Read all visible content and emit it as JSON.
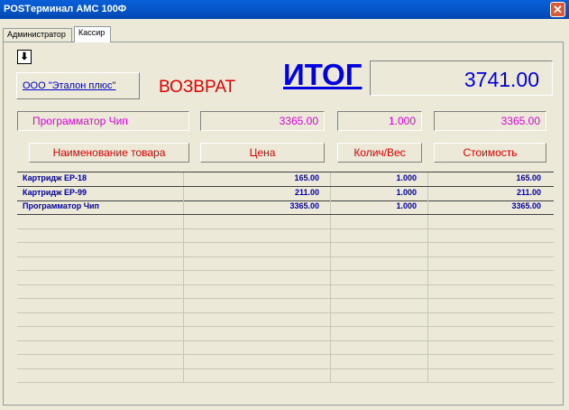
{
  "window": {
    "title": "POSTерминал АМС 100Ф"
  },
  "tabs": [
    {
      "label": "Администратор"
    },
    {
      "label": "Кассир"
    }
  ],
  "toolbar": {
    "arrow_glyph": "⬇"
  },
  "org": {
    "name": "ООО \"Эталон плюс\""
  },
  "mode": {
    "label": "ВОЗВРАТ"
  },
  "total": {
    "label": "ИТОГ",
    "value": "3741.00"
  },
  "current_item": {
    "name": "Программатор Чип",
    "price": "3365.00",
    "qty": "1.000",
    "cost": "3365.00"
  },
  "columns": {
    "name": "Наименование товара",
    "price": "Цена",
    "qty": "Колич/Вес",
    "cost": "Стоимость"
  },
  "items": [
    {
      "name": "Картридж ЕР-18",
      "price": "165.00",
      "qty": "1.000",
      "cost": "165.00"
    },
    {
      "name": "Картридж ЕР-99",
      "price": "211.00",
      "qty": "1.000",
      "cost": "211.00"
    },
    {
      "name": "Программатор Чип",
      "price": "3365.00",
      "qty": "1.000",
      "cost": "3365.00"
    }
  ],
  "colors": {
    "accent_blue": "#0000e0",
    "return_red": "#e00000",
    "current_magenta": "#e000e0"
  }
}
